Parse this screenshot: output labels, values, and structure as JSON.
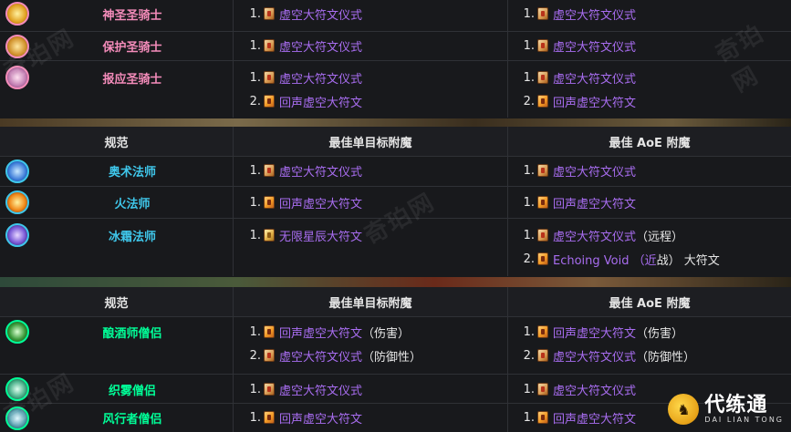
{
  "paladin_table": {
    "rows": [
      {
        "spec": "神圣圣骑士",
        "icon": "holy-paladin-icon",
        "color": "#f48cba",
        "single": [
          {
            "n": "1.",
            "name": "虚空大符文仪式",
            "note": "",
            "scroll": "red"
          }
        ],
        "aoe": [
          {
            "n": "1.",
            "name": "虚空大符文仪式",
            "note": "",
            "scroll": "red"
          }
        ]
      },
      {
        "spec": "保护圣骑士",
        "icon": "protection-paladin-icon",
        "color": "#f48cba",
        "single": [
          {
            "n": "1.",
            "name": "虚空大符文仪式",
            "note": "",
            "scroll": "red"
          }
        ],
        "aoe": [
          {
            "n": "1.",
            "name": "虚空大符文仪式",
            "note": "",
            "scroll": "red"
          }
        ]
      },
      {
        "spec": "报应圣骑士",
        "icon": "retribution-paladin-icon",
        "color": "#f48cba",
        "single": [
          {
            "n": "1.",
            "name": "虚空大符文仪式",
            "note": "",
            "scroll": "red"
          },
          {
            "n": "2.",
            "name": "回声虚空大符文",
            "note": "",
            "scroll": "orange"
          }
        ],
        "aoe": [
          {
            "n": "1.",
            "name": "虚空大符文仪式",
            "note": "",
            "scroll": "red"
          },
          {
            "n": "2.",
            "name": "回声虚空大符文",
            "note": "",
            "scroll": "orange"
          }
        ]
      }
    ]
  },
  "mage_table": {
    "header": {
      "spec": "规范",
      "single": "最佳单目标附魔",
      "aoe": "最佳 AoE 附魔"
    },
    "rows": [
      {
        "spec": "奥术法师",
        "icon": "arcane-mage-icon",
        "color": "#3fc7eb",
        "single": [
          {
            "n": "1.",
            "name": "虚空大符文仪式",
            "note": "",
            "scroll": "red"
          }
        ],
        "aoe": [
          {
            "n": "1.",
            "name": "虚空大符文仪式",
            "note": "",
            "scroll": "red"
          }
        ]
      },
      {
        "spec": "火法师",
        "icon": "fire-mage-icon",
        "color": "#3fc7eb",
        "single": [
          {
            "n": "1.",
            "name": "回声虚空大符文",
            "note": "",
            "scroll": "orange"
          }
        ],
        "aoe": [
          {
            "n": "1.",
            "name": "回声虚空大符文",
            "note": "",
            "scroll": "orange"
          }
        ]
      },
      {
        "spec": "冰霜法师",
        "icon": "frost-mage-icon",
        "color": "#3fc7eb",
        "single": [
          {
            "n": "1.",
            "name": "无限星辰大符文",
            "note": "",
            "scroll": "gold"
          }
        ],
        "aoe": [
          {
            "n": "1.",
            "name": "虚空大符文仪式",
            "note": "（远程）",
            "scroll": "red"
          },
          {
            "n": "2.",
            "name": "Echoing Void （近",
            "note": "战） 大符文",
            "scroll": "orange"
          }
        ]
      }
    ]
  },
  "monk_table": {
    "header": {
      "spec": "规范",
      "single": "最佳单目标附魔",
      "aoe": "最佳 AoE 附魔"
    },
    "rows": [
      {
        "spec": "酿酒师僧侣",
        "icon": "brewmaster-monk-icon",
        "color": "#00ff98",
        "single": [
          {
            "n": "1.",
            "name": "回声虚空大符文",
            "note": "（伤害）",
            "scroll": "orange"
          },
          {
            "n": "2.",
            "name": "虚空大符文仪式",
            "note": "（防御性）",
            "scroll": "red"
          }
        ],
        "aoe": [
          {
            "n": "1.",
            "name": "回声虚空大符文",
            "note": "（伤害）",
            "scroll": "orange"
          },
          {
            "n": "2.",
            "name": "虚空大符文仪式",
            "note": "（防御性）",
            "scroll": "red"
          }
        ]
      },
      {
        "spec": "织雾僧侣",
        "icon": "mistweaver-monk-icon",
        "color": "#00ff98",
        "single": [
          {
            "n": "1.",
            "name": "虚空大符文仪式",
            "note": "",
            "scroll": "red"
          }
        ],
        "aoe": [
          {
            "n": "1.",
            "name": "虚空大符文仪式",
            "note": "",
            "scroll": "red"
          }
        ]
      },
      {
        "spec": "风行者僧侣",
        "icon": "windwalker-monk-icon",
        "color": "#00ff98",
        "single": [
          {
            "n": "1.",
            "name": "回声虚空大符文",
            "note": "",
            "scroll": "orange"
          }
        ],
        "aoe": [
          {
            "n": "1.",
            "name": "回声虚空大符文",
            "note": "",
            "scroll": "orange"
          }
        ]
      }
    ]
  },
  "watermark": {
    "text": "奇珀网"
  },
  "brand": {
    "cn": "代练通",
    "en": "DAI LIAN TONG",
    "logo_glyph": "♞"
  }
}
